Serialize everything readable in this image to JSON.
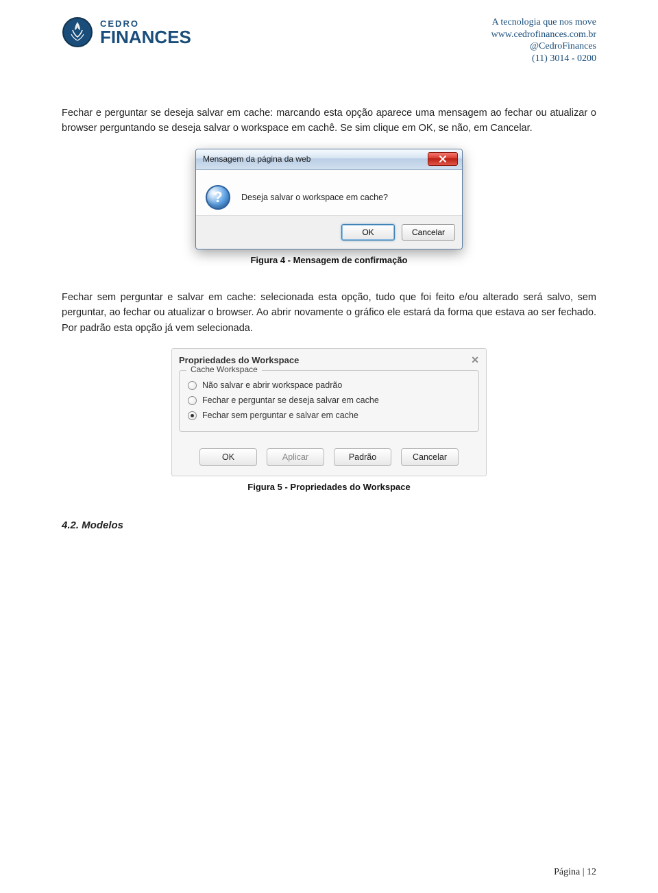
{
  "header": {
    "logo_top": "CEDRO",
    "logo_bottom": "FINANCES",
    "tagline": "A tecnologia que nos move",
    "url": "www.cedrofinances.com.br",
    "handle": "@CedroFinances",
    "phone": "(11) 3014 - 0200"
  },
  "para1": "Fechar e perguntar se deseja salvar em cache: marcando esta opção aparece uma mensagem ao fechar ou atualizar o browser perguntando se deseja salvar o workspace em cachê. Se sim clique em OK, se não, em Cancelar.",
  "fig4": {
    "title": "Mensagem da página da web",
    "message": "Deseja salvar o workspace em cache?",
    "ok": "OK",
    "cancel": "Cancelar",
    "caption": "Figura 4 - Mensagem de confirmação"
  },
  "para2": "Fechar sem perguntar e salvar em cache: selecionada esta opção, tudo que foi feito e/ou alterado será salvo, sem perguntar, ao fechar ou atualizar o browser. Ao abrir novamente o gráfico ele estará da forma que estava ao ser fechado. Por padrão esta opção já vem selecionada.",
  "fig5": {
    "title": "Propriedades do Workspace",
    "legend": "Cache Workspace",
    "options": [
      "Não salvar e abrir workspace padrão",
      "Fechar e perguntar se deseja salvar em cache",
      "Fechar sem perguntar e salvar em cache"
    ],
    "selected_index": 2,
    "buttons": {
      "ok": "OK",
      "apply": "Aplicar",
      "default": "Padrão",
      "cancel": "Cancelar"
    },
    "caption": "Figura 5 - Propriedades do Workspace"
  },
  "section": "4.2. Modelos",
  "footer": {
    "label": "Página",
    "sep": " | ",
    "num": "12"
  }
}
